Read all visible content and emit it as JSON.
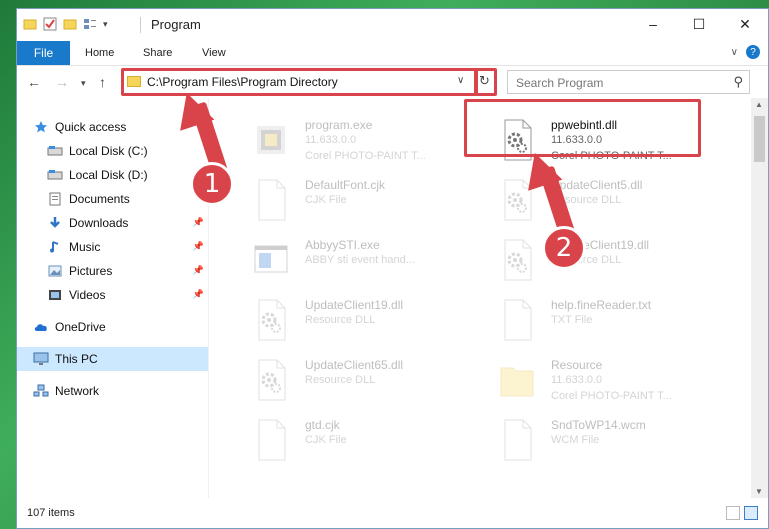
{
  "window": {
    "title": "Program",
    "ribbon_tabs": [
      "File",
      "Home",
      "Share",
      "View"
    ],
    "window_buttons": [
      "–",
      "☐",
      "✕"
    ]
  },
  "address": {
    "path": "C:\\Program Files\\Program Directory",
    "search_placeholder": "Search Program"
  },
  "sidebar": {
    "items": [
      {
        "label": "Quick access",
        "icon": "star-icon",
        "pinned": false
      },
      {
        "label": "Local Disk (C:)",
        "icon": "drive-icon",
        "pinned": false
      },
      {
        "label": "Local Disk (D:)",
        "icon": "drive-icon",
        "pinned": false
      },
      {
        "label": "Documents",
        "icon": "document-icon",
        "pinned": false
      },
      {
        "label": "Downloads",
        "icon": "download-icon",
        "pinned": true
      },
      {
        "label": "Music",
        "icon": "music-icon",
        "pinned": true
      },
      {
        "label": "Pictures",
        "icon": "picture-icon",
        "pinned": true
      },
      {
        "label": "Videos",
        "icon": "video-icon",
        "pinned": true
      },
      {
        "label": "OneDrive",
        "icon": "cloud-icon",
        "pinned": false
      },
      {
        "label": "This PC",
        "icon": "computer-icon",
        "pinned": false,
        "selected": true
      },
      {
        "label": "Network",
        "icon": "network-icon",
        "pinned": false
      }
    ]
  },
  "files": [
    {
      "name": "program.exe",
      "type": "11.633.0.0",
      "desc": "Corel PHOTO-PAINT T...",
      "icon": "exe-icon",
      "faded": true
    },
    {
      "name": "ppwebintl.dll",
      "type": "11.633.0.0",
      "desc": "Corel PHOTO-PAINT T...",
      "icon": "dll-gear-icon",
      "faded": false
    },
    {
      "name": "DefaultFont.cjk",
      "type": "CJK File",
      "desc": "",
      "icon": "blank-file-icon",
      "faded": true
    },
    {
      "name": "UpdateClient5.dll",
      "type": "Resource DLL",
      "desc": "",
      "icon": "dll-gear-icon",
      "faded": true
    },
    {
      "name": "AbbyySTI.exe",
      "type": "ABBY sti event hand...",
      "desc": "",
      "icon": "app-window-icon",
      "faded": true
    },
    {
      "name": "UpdateClient19.dll",
      "type": "Resource DLL",
      "desc": "",
      "icon": "dll-gear-icon",
      "faded": true
    },
    {
      "name": "UpdateClient19.dll",
      "type": "Resource DLL",
      "desc": "",
      "icon": "dll-gear-icon",
      "faded": true
    },
    {
      "name": "help.fineReader.txt",
      "type": "TXT File",
      "desc": "",
      "icon": "blank-file-icon",
      "faded": true
    },
    {
      "name": "UpdateClient65.dll",
      "type": "Resource DLL",
      "desc": "",
      "icon": "dll-gear-icon",
      "faded": true
    },
    {
      "name": "Resource",
      "type": "11.633.0.0",
      "desc": "Corel PHOTO-PAINT T...",
      "icon": "folder-icon",
      "faded": true
    },
    {
      "name": "gtd.cjk",
      "type": "CJK File",
      "desc": "",
      "icon": "blank-file-icon",
      "faded": true
    },
    {
      "name": "SndToWP14.wcm",
      "type": "WCM File",
      "desc": "",
      "icon": "blank-file-icon",
      "faded": true
    }
  ],
  "status": {
    "item_count": "107 items"
  },
  "annotations": {
    "step1": "1",
    "step2": "2",
    "accent": "#d9434a"
  }
}
